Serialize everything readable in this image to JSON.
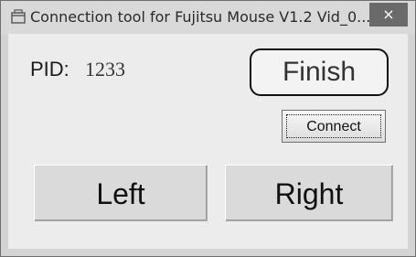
{
  "window": {
    "title": "Connection tool for Fujitsu Mouse V1.2  Vid_0...",
    "close_glyph": "×"
  },
  "pid": {
    "label": "PID:",
    "value": "1233"
  },
  "status": {
    "text": "Finish"
  },
  "buttons": {
    "connect": "Connect",
    "left": "Left",
    "right": "Right"
  },
  "icons": {
    "app_icon": "app-window-icon",
    "close_icon": "close-icon"
  }
}
